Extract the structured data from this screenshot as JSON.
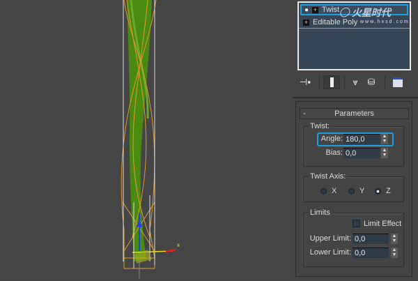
{
  "stack": {
    "items": [
      {
        "label": "Twist",
        "selected": true
      },
      {
        "label": "Editable Poly",
        "selected": false
      }
    ]
  },
  "watermark": {
    "brand": "火星时代",
    "url": "www.hxsd.com"
  },
  "rollout": {
    "toggle": "-",
    "title": "Parameters"
  },
  "twist": {
    "group": "Twist:",
    "angle_label": "Angle:",
    "angle_value": "180,0",
    "bias_label": "Bias:",
    "bias_value": "0,0"
  },
  "axis": {
    "group": "Twist Axis:",
    "options": [
      "X",
      "Y",
      "Z"
    ],
    "selected": "Z"
  },
  "limits": {
    "group": "Limits",
    "limit_effect": "Limit Effect",
    "limit_effect_checked": false,
    "upper_label": "Upper Limit:",
    "upper_value": "0,0",
    "lower_label": "Lower Limit:",
    "lower_value": "0,0"
  },
  "gizmo": {
    "x_label": "x"
  },
  "colors": {
    "highlight": "#1ea0e0",
    "mesh": "#4a8a10",
    "gizmo": "#e09a30"
  }
}
